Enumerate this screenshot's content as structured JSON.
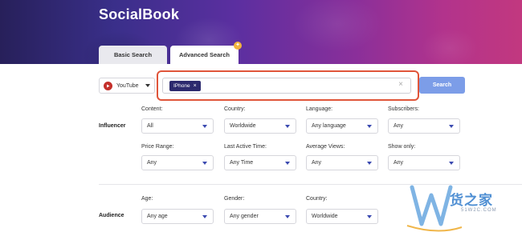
{
  "brand": "SocialBook",
  "tabs": {
    "basic": "Basic Search",
    "advanced": "Advanced Search"
  },
  "search": {
    "platform": "YouTube",
    "keyword_chip": "IPhone",
    "chip_remove": "×",
    "clear": "×",
    "button": "Search"
  },
  "influencer": {
    "section": "Influencer",
    "fields": [
      {
        "label": "Content:",
        "value": "All"
      },
      {
        "label": "Country:",
        "value": "Worldwide"
      },
      {
        "label": "Language:",
        "value": "Any language"
      },
      {
        "label": "Subscribers:",
        "value": "Any"
      },
      {
        "label": "Price Range:",
        "value": "Any"
      },
      {
        "label": "Last Active Time:",
        "value": "Any Time"
      },
      {
        "label": "Average Views:",
        "value": "Any"
      },
      {
        "label": "Show only:",
        "value": "Any"
      }
    ]
  },
  "audience": {
    "section": "Audience",
    "fields": [
      {
        "label": "Age:",
        "value": "Any age"
      },
      {
        "label": "Gender:",
        "value": "Any gender"
      },
      {
        "label": "Country:",
        "value": "Worldwide"
      }
    ]
  },
  "watermark": {
    "text": "货之家",
    "sub": "51W2C.COM"
  },
  "colors": {
    "accent": "#7c9de8",
    "chip": "#2c2a6e",
    "highlight": "#e0553a",
    "youtube": "#c4302b"
  }
}
